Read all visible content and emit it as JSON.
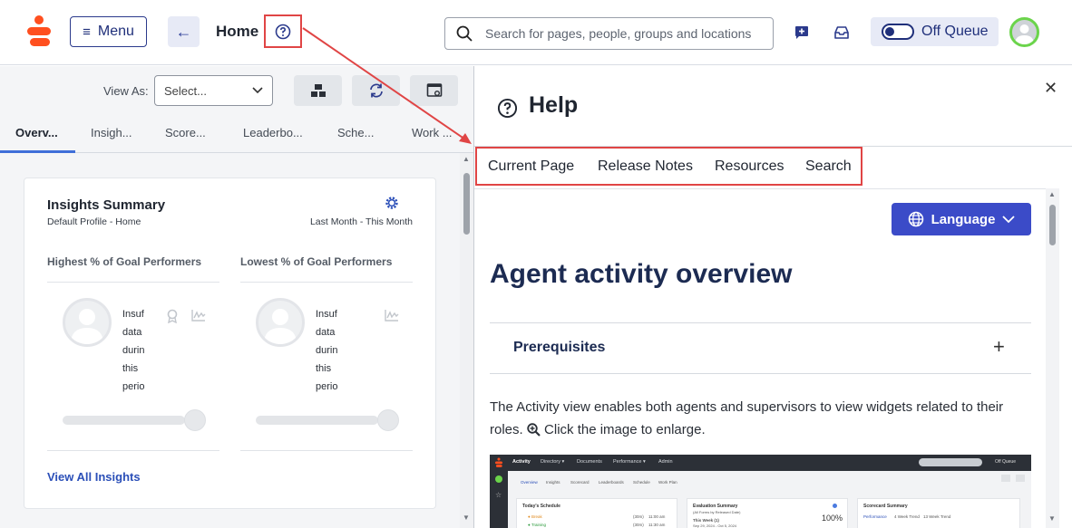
{
  "topbar": {
    "menu_label": "Menu",
    "page_title": "Home",
    "search_placeholder": "Search for pages, people, groups and locations",
    "queue_label": "Off Queue",
    "icons": [
      "logo-icon",
      "menu-icon",
      "back-arrow-icon",
      "help-icon",
      "search-icon",
      "chat-add-icon",
      "inbox-icon",
      "queue-toggle",
      "avatar"
    ]
  },
  "left": {
    "view_as_label": "View As:",
    "view_as_value": "Select...",
    "tabs": [
      "Overv...",
      "Insigh...",
      "Score...",
      "Leaderbo...",
      "Sche...",
      "Work ..."
    ],
    "card": {
      "title": "Insights Summary",
      "subtitle": "Default Profile - Home",
      "range": "Last Month - This Month",
      "highest_label": "Highest % of Goal Performers",
      "lowest_label": "Lowest % of Goal Performers",
      "insufficient_lines": [
        "Insuf",
        "data",
        "durin",
        "this",
        "perio"
      ],
      "view_all": "View All Insights"
    }
  },
  "help": {
    "title": "Help",
    "tabs": [
      "Current Page",
      "Release Notes",
      "Resources",
      "Search"
    ],
    "language_label": "Language",
    "article_title": "Agent activity overview",
    "accordion_title": "Prerequisites",
    "body_line1": "The Activity view enables both agents and supervisors to view widgets related to their",
    "body_line2_prefix": "roles.",
    "body_line2_suffix": "Click the image to enlarge.",
    "screenshot": {
      "nav": [
        "Activity",
        "Directory ▾",
        "Documents",
        "Performance ▾",
        "Admin"
      ],
      "tabs": [
        "Overview",
        "Insights",
        "Scorecard",
        "Leaderboards",
        "Schedule",
        "Work Plan"
      ],
      "off_queue": "Off Queue",
      "schedule_title": "Today's Schedule",
      "schedule_rows": [
        {
          "label": "● Break",
          "dur": "(30m)",
          "time": "11:00 am"
        },
        {
          "label": "● Training",
          "dur": "(30m)",
          "time": "11:30 am"
        }
      ],
      "eval_title": "Evaluation Summary",
      "eval_sub": "(All Forms by Released Date)",
      "eval_week": "This Week (1)",
      "eval_dates": "Sep 29, 2024 - Oct 5, 2024",
      "eval_value": "100%",
      "scorecard_title": "Scorecard Summary",
      "scorecard_tabs": [
        "Performance",
        "4 Week Trend",
        "13 Week Trend"
      ]
    }
  }
}
